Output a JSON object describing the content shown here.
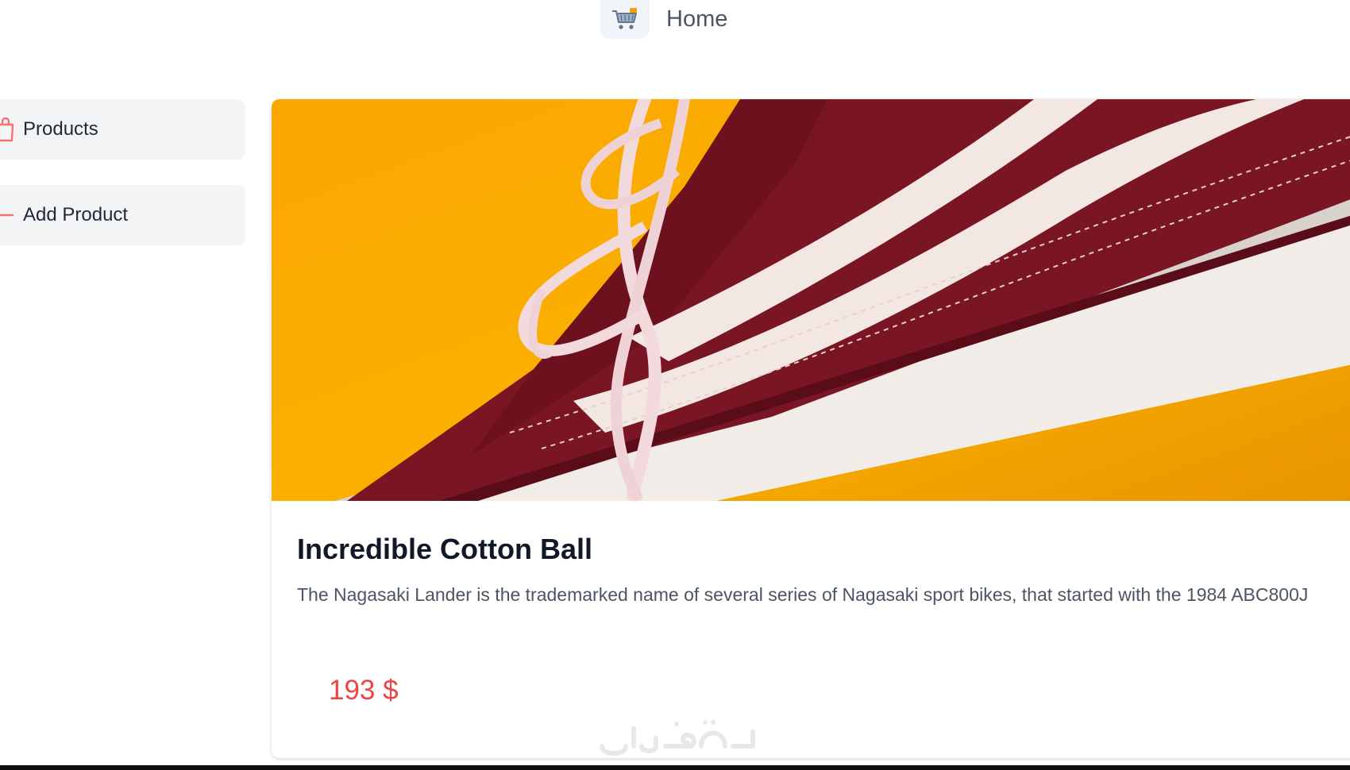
{
  "header": {
    "home_label": "Home",
    "icon": "shopping-cart-icon"
  },
  "sidebar": {
    "items": [
      {
        "label": "Products",
        "icon": "shopping-bag-icon",
        "icon_color": "#f87171"
      },
      {
        "label": "Add Product",
        "icon": "minus-icon",
        "icon_color": "#f87171"
      }
    ]
  },
  "product": {
    "title": "Incredible Cotton Ball",
    "description": "The Nagasaki Lander is the trademarked name of several series of Nagasaki sport bikes, that started with the 1984 ABC800J",
    "price": "193 $",
    "price_color": "#ef4444",
    "image": "sneaker-photo"
  },
  "watermark": {
    "text": "خمسات"
  }
}
